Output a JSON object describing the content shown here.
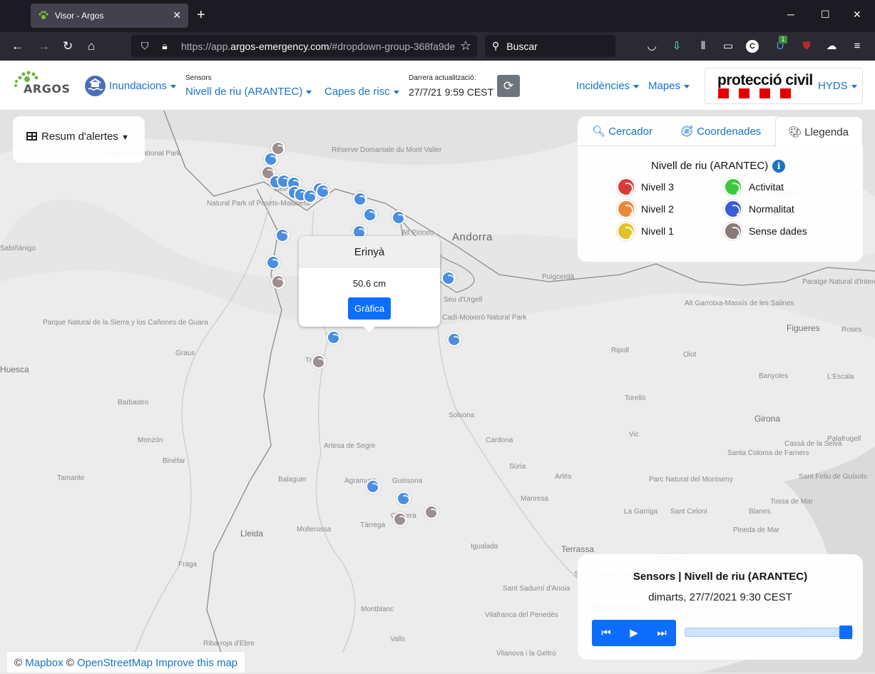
{
  "browser": {
    "tab_title": "Visor - Argos",
    "url_prefix": "https://app.",
    "url_domain": "argos-emergency.com",
    "url_rest": "/#dropdown-group-368fa9de",
    "search_placeholder": "Buscar",
    "ext_badge": "1"
  },
  "header": {
    "logo_text": "ARGOS",
    "risk_menu": "Inundacions",
    "sensors_label": "Sensors",
    "sensors_menu": "Nivell de riu (ARANTEC)",
    "layers_menu": "Capes de risc",
    "updated_label": "Darrera actualització:",
    "updated_value": "27/7/21 9:59 CEST",
    "incidents_menu": "Incidències",
    "maps_menu": "Mapes",
    "brand_text": "protecció civil",
    "user_menu": "HYDS"
  },
  "alerts_summary": {
    "label": "Resum d'alertes"
  },
  "legend": {
    "tabs": [
      "Cercador",
      "Coordenades",
      "Llegenda"
    ],
    "active_tab": "Llegenda",
    "title": "Nivell de riu (ARANTEC)",
    "items": [
      {
        "label": "Nivell 3",
        "color": "#d93b3b"
      },
      {
        "label": "Activitat",
        "color": "#3ec73e"
      },
      {
        "label": "Nivell 2",
        "color": "#e8893a"
      },
      {
        "label": "Normalitat",
        "color": "#3b5bd9"
      },
      {
        "label": "Nivell 1",
        "color": "#e0c229"
      },
      {
        "label": "Sense dades",
        "color": "#8a7a7a"
      }
    ]
  },
  "popup": {
    "station": "Erinyà",
    "value": "50.6 cm",
    "button": "Gràfica"
  },
  "player": {
    "title": "Sensors | Nivell de riu (ARANTEC)",
    "date": "dimarts, 27/7/2021 9:30 CEST",
    "position": 1.0
  },
  "attribution": {
    "copy1": "©",
    "mapbox": "Mapbox",
    "copy2": "©",
    "osm": "OpenStreetMap",
    "improve": "Improve this map"
  },
  "map_places": [
    "Pyrenees National Park",
    "Réserve Domaniale du Mont Valier",
    "Vielha",
    "Natural Park of Posets-Maladeta",
    "Alt Pirineu",
    "Andorra",
    "Sabiñánigo",
    "Puigcerdà",
    "Perpignan",
    "Paratge Natural d'Interès Nacional de l'Albera",
    "Cadí-Moixeró Natural Park",
    "Seu d'Urgell",
    "Alt Garrotxa-Massís de les Salines",
    "Figueres",
    "Roses",
    "Parque Natural de la Sierra y los Cañones de Guara",
    "Graus",
    "Ripoll",
    "Olot",
    "Banyoles",
    "L'Escala",
    "Huesca",
    "Tremp",
    "Torelló",
    "Barbastro",
    "Solsona",
    "Girona",
    "Monzón",
    "Vic",
    "Cardona",
    "Palafrugell",
    "Santa Coloma de Farners",
    "Cassà de la Selva",
    "Artesa de Segre",
    "Binéfar",
    "Súria",
    "Tamarite",
    "Guissona",
    "Artés",
    "Balaguer",
    "Agramunt",
    "Parc Natural del Montseny",
    "Sant Feliu de Guíxols",
    "Manresa",
    "Tossa de Mar",
    "Cervera",
    "La Garriga",
    "Sant Celoni",
    "Blanes",
    "Lleida",
    "Mollerussa",
    "Tàrrega",
    "Igualada",
    "Pineda de Mar",
    "Terrassa",
    "Mataró",
    "Fraga",
    "Sant Cugat del Vallès",
    "Sant Sadurní d'Anoia",
    "Barcelona",
    "Vilafranca del Penedès",
    "Montblanc",
    "Valls",
    "Riba-roja d'Ebre",
    "Vilanova i la Geltrú"
  ],
  "stations": [
    {
      "status": "gray"
    },
    {
      "status": "blue"
    },
    {
      "status": "gray"
    },
    {
      "status": "blue"
    },
    {
      "status": "blue"
    },
    {
      "status": "blue"
    },
    {
      "status": "blue"
    },
    {
      "status": "blue"
    },
    {
      "status": "blue"
    },
    {
      "status": "blue"
    },
    {
      "status": "blue"
    },
    {
      "status": "blue"
    },
    {
      "status": "blue"
    },
    {
      "status": "blue"
    },
    {
      "status": "blue"
    },
    {
      "status": "blue"
    },
    {
      "status": "gray"
    },
    {
      "status": "blue"
    },
    {
      "status": "blue"
    },
    {
      "status": "blue"
    },
    {
      "status": "gray"
    },
    {
      "status": "blue"
    },
    {
      "status": "blue"
    },
    {
      "status": "blue"
    },
    {
      "status": "gray"
    },
    {
      "status": "gray"
    }
  ],
  "colors": {
    "accent": "#1a73c8",
    "primary_button": "#0d6efd",
    "brand_red": "#e00000"
  }
}
